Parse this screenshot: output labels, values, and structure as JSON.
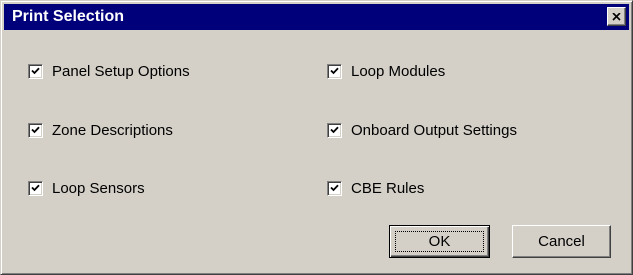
{
  "window": {
    "title": "Print Selection",
    "close_icon": "close-icon",
    "colors": {
      "titlebar": "#00007b",
      "title_text": "#ffffff",
      "face": "#d4d0c8"
    }
  },
  "options": {
    "left": [
      {
        "label": "Panel Setup Options",
        "checked": true
      },
      {
        "label": "Zone Descriptions",
        "checked": true
      },
      {
        "label": "Loop Sensors",
        "checked": true
      }
    ],
    "right": [
      {
        "label": "Loop Modules",
        "checked": true
      },
      {
        "label": "Onboard Output Settings",
        "checked": true
      },
      {
        "label": "CBE Rules",
        "checked": true
      }
    ]
  },
  "buttons": {
    "ok_label": "OK",
    "cancel_label": "Cancel"
  }
}
